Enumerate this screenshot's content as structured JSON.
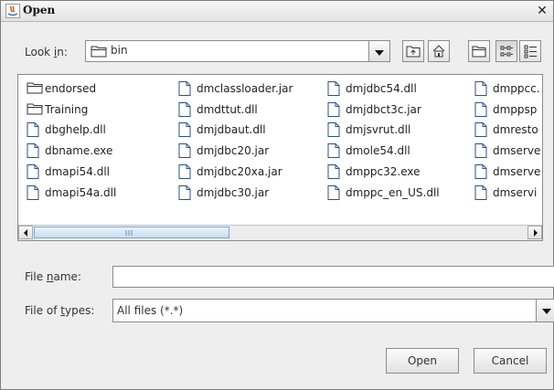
{
  "window": {
    "title": "Open",
    "close_glyph": "✕"
  },
  "look_in": {
    "label_pre": "Look ",
    "label_mnemonic": "i",
    "label_post": "n:",
    "value": "bin",
    "icon": "folder-icon"
  },
  "toolbar": {
    "buttons": [
      {
        "name": "up-one-level-button",
        "icon": "up-folder-icon"
      },
      {
        "name": "home-button",
        "icon": "home-icon"
      },
      {
        "name": "new-folder-button",
        "icon": "new-folder-icon"
      },
      {
        "name": "list-view-button",
        "icon": "list-view-icon",
        "pressed": true
      },
      {
        "name": "details-view-button",
        "icon": "details-view-icon"
      }
    ]
  },
  "files": {
    "col1": [
      {
        "name": "endorsed",
        "type": "folder"
      },
      {
        "name": "Training",
        "type": "folder"
      },
      {
        "name": "dbghelp.dll",
        "type": "file"
      },
      {
        "name": "dbname.exe",
        "type": "file"
      },
      {
        "name": "dmapi54.dll",
        "type": "file"
      },
      {
        "name": "dmapi54a.dll",
        "type": "file"
      }
    ],
    "col2": [
      {
        "name": "dmclassloader.jar",
        "type": "file"
      },
      {
        "name": "dmdttut.dll",
        "type": "file"
      },
      {
        "name": "dmjdbaut.dll",
        "type": "file"
      },
      {
        "name": "dmjdbc20.jar",
        "type": "file"
      },
      {
        "name": "dmjdbc20xa.jar",
        "type": "file"
      },
      {
        "name": "dmjdbc30.jar",
        "type": "file"
      }
    ],
    "col3": [
      {
        "name": "dmjdbc54.dll",
        "type": "file"
      },
      {
        "name": "dmjdbct3c.jar",
        "type": "file"
      },
      {
        "name": "dmjsvrut.dll",
        "type": "file"
      },
      {
        "name": "dmole54.dll",
        "type": "file"
      },
      {
        "name": "dmppc32.exe",
        "type": "file"
      },
      {
        "name": "dmppc_en_US.dll",
        "type": "file"
      }
    ],
    "col4": [
      {
        "name": "dmppcc.",
        "type": "file"
      },
      {
        "name": "dmppsp",
        "type": "file"
      },
      {
        "name": "dmresto",
        "type": "file"
      },
      {
        "name": "dmserve",
        "type": "file"
      },
      {
        "name": "dmserve",
        "type": "file"
      },
      {
        "name": "dmservi",
        "type": "file"
      }
    ]
  },
  "file_name": {
    "label_pre": "File ",
    "label_mnemonic": "n",
    "label_post": "ame:",
    "value": ""
  },
  "file_types": {
    "label_pre": "File of ",
    "label_mnemonic": "t",
    "label_post": "ypes:",
    "value": "All files (*.*)"
  },
  "buttons": {
    "open": "Open",
    "cancel": "Cancel"
  }
}
